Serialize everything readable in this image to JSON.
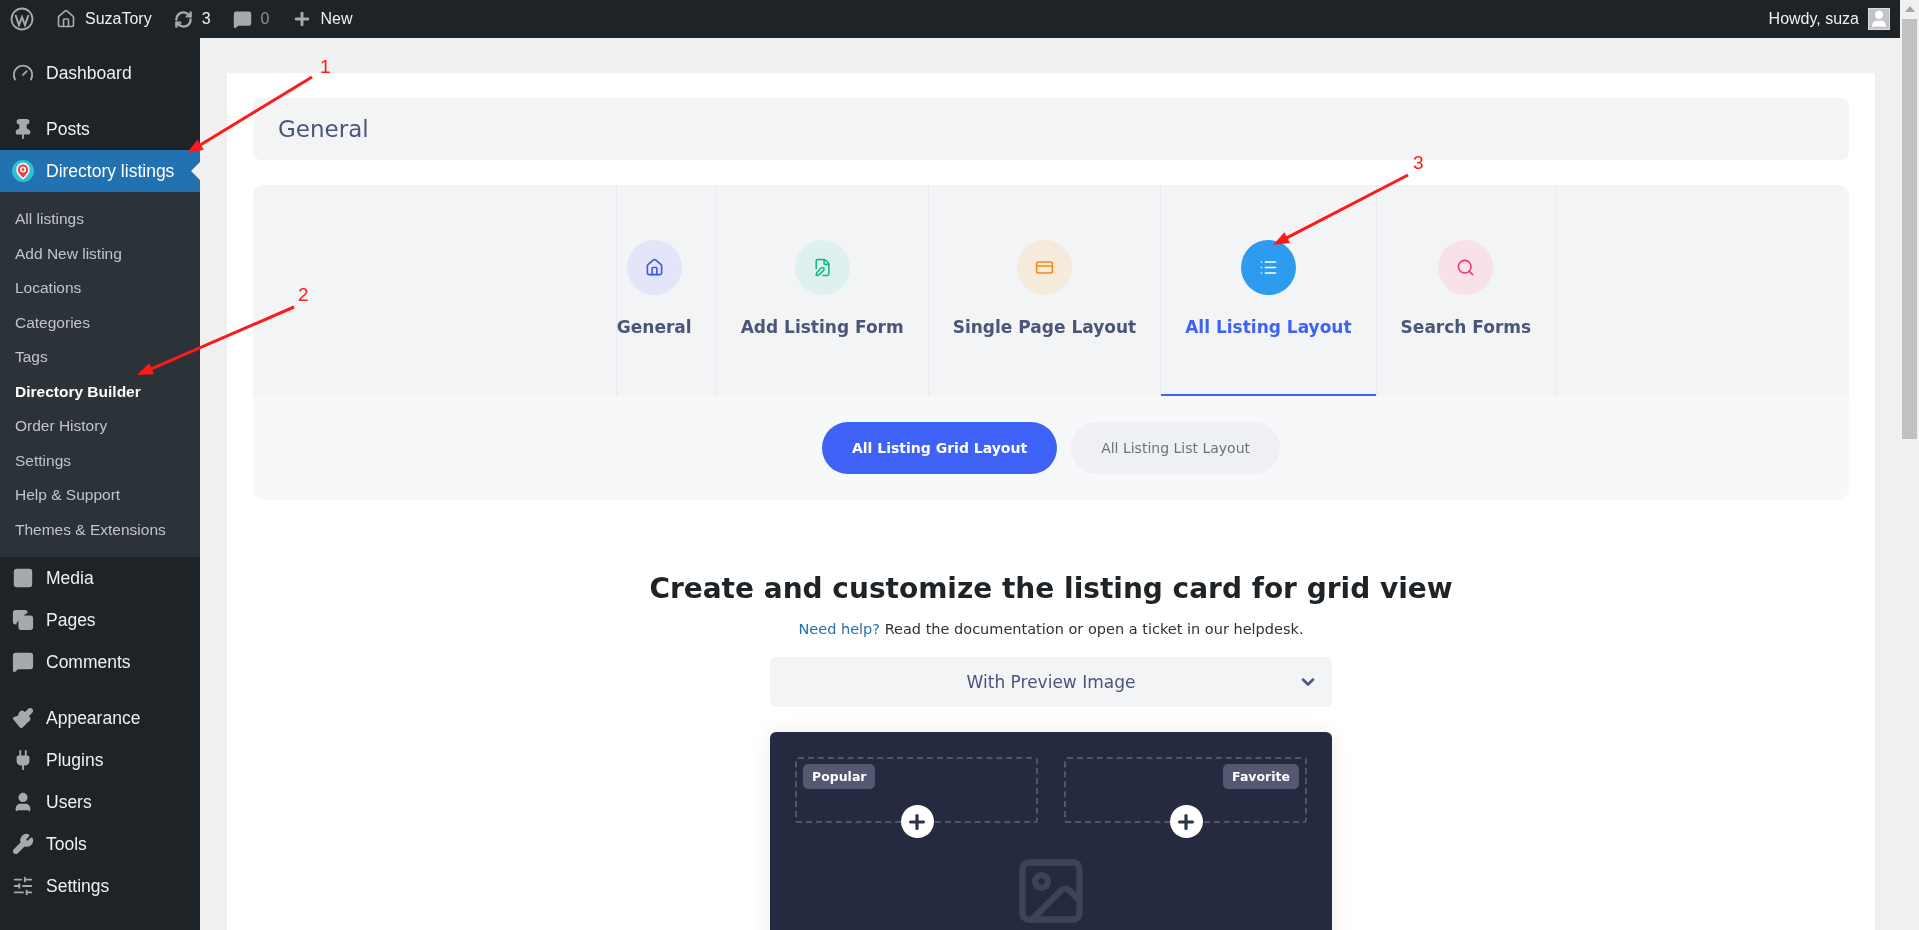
{
  "admin_bar": {
    "site": "SuzaTory",
    "updates": "3",
    "comments": "0",
    "new": "New",
    "greeting": "Howdy, suza"
  },
  "sidebar": {
    "groups": [
      {
        "items": [
          {
            "label": "Dashboard",
            "selected": false
          }
        ]
      },
      {
        "items": [
          {
            "label": "Posts",
            "selected": false
          },
          {
            "label": "Directory listings",
            "selected": true,
            "children": [
              {
                "label": "All listings",
                "selected": false
              },
              {
                "label": "Add New listing",
                "selected": false
              },
              {
                "label": "Locations",
                "selected": false
              },
              {
                "label": "Categories",
                "selected": false
              },
              {
                "label": "Tags",
                "selected": false
              },
              {
                "label": "Directory Builder",
                "selected": true
              },
              {
                "label": "Order History",
                "selected": false
              },
              {
                "label": "Settings",
                "selected": false
              },
              {
                "label": "Help & Support",
                "selected": false
              },
              {
                "label": "Themes & Extensions",
                "selected": false
              }
            ]
          },
          {
            "label": "Media",
            "selected": false
          },
          {
            "label": "Pages",
            "selected": false
          },
          {
            "label": "Comments",
            "selected": false
          }
        ]
      },
      {
        "items": [
          {
            "label": "Appearance",
            "selected": false
          },
          {
            "label": "Plugins",
            "selected": false
          },
          {
            "label": "Users",
            "selected": false
          },
          {
            "label": "Tools",
            "selected": false
          },
          {
            "label": "Settings",
            "selected": false
          }
        ]
      }
    ]
  },
  "section_title": "General",
  "tabs": [
    {
      "label": "General",
      "selected": false
    },
    {
      "label": "Add Listing Form",
      "selected": false
    },
    {
      "label": "Single Page Layout",
      "selected": false
    },
    {
      "label": "All Listing Layout",
      "selected": true
    },
    {
      "label": "Search Forms",
      "selected": false
    }
  ],
  "layout_tabs": [
    {
      "label": "All Listing Grid Layout",
      "selected": true
    },
    {
      "label": "All Listing List Layout",
      "selected": false
    }
  ],
  "heading": "Create and customize the listing card for grid view",
  "help": {
    "link": "Need help?",
    "text": "Read the documentation or open a ticket in our helpdesk."
  },
  "card_type": {
    "value": "With Preview Image"
  },
  "card_slots": [
    {
      "badge": "Popular"
    },
    {
      "badge": "Favorite"
    }
  ],
  "annotations": [
    {
      "label": "1"
    },
    {
      "label": "2"
    },
    {
      "label": "3"
    }
  ]
}
